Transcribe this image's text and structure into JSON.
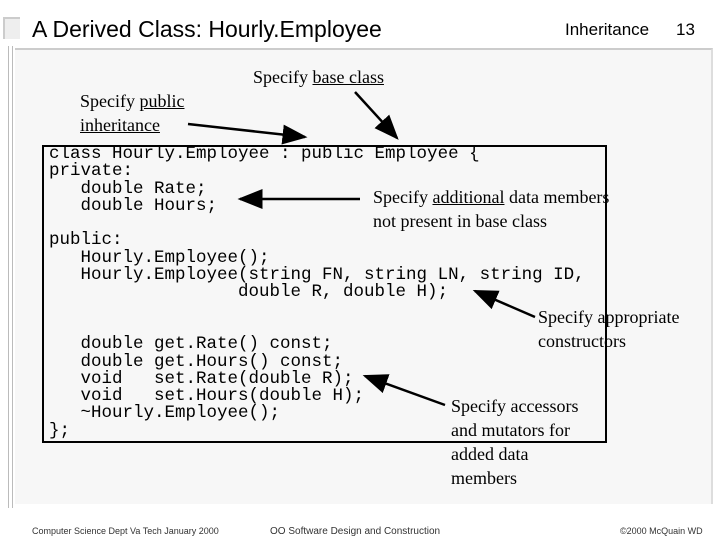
{
  "header": {
    "title": "A Derived Class: Hourly.Employee",
    "section": "Inheritance",
    "page": "13"
  },
  "code": {
    "lines": [
      "class Hourly.Employee : public Employee {",
      "private:",
      "   double Rate;",
      "   double Hours;",
      "",
      "public:",
      "   Hourly.Employee();",
      "   Hourly.Employee(string FN, string LN, string ID,",
      "                  double R, double H);",
      "",
      "",
      "   double get.Rate() const;",
      "   double get.Hours() const;",
      "   void   set.Rate(double R);",
      "   void   set.Hours(double H);",
      "   ~Hourly.Employee();",
      "};"
    ]
  },
  "notes": {
    "base_pre": "Specify ",
    "base_u": "base class",
    "public_pre": "Specify ",
    "public_u": "public",
    "public_u2": "inheritance",
    "members_pre": "Specify ",
    "members_u": "additional",
    "members_post": " data members",
    "members_line2": "not present in base class",
    "ctor": "Specify appropriate",
    "ctor2": "constructors",
    "acc1": "Specify accessors",
    "acc2": "and mutators for",
    "acc3": "added data",
    "acc4": "members"
  },
  "footer": {
    "left": "Computer Science Dept Va Tech January 2000",
    "center": "OO Software Design and Construction",
    "right": "©2000 McQuain WD"
  }
}
